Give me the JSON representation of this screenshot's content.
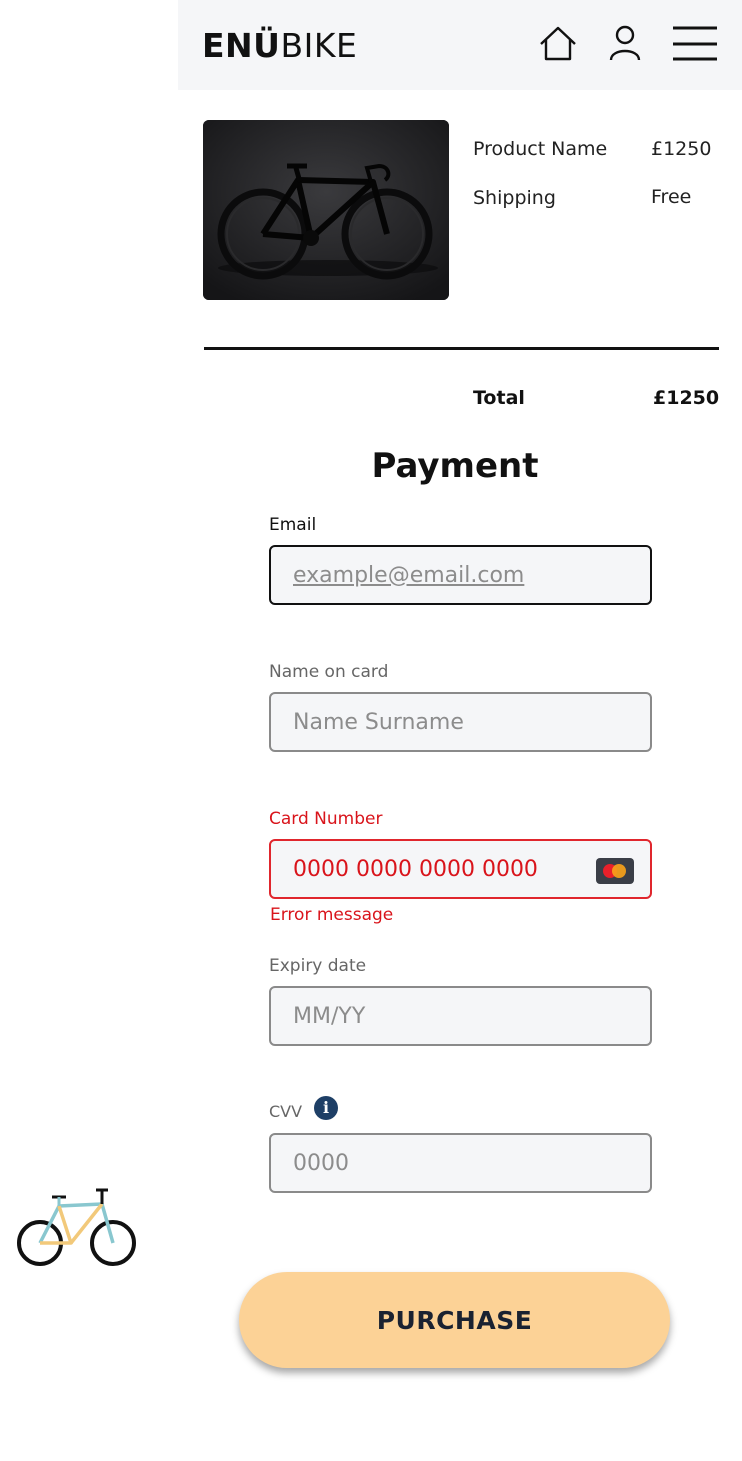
{
  "header": {
    "logo_strong": "ENÜ",
    "logo_light": "BIKE",
    "icons": [
      "home-icon",
      "user-icon",
      "menu-icon"
    ]
  },
  "order": {
    "product_label": "Product Name",
    "product_price": "£1250",
    "shipping_label": "Shipping",
    "shipping_value": "Free",
    "total_label": "Total",
    "total_value": "£1250"
  },
  "payment": {
    "title": "Payment",
    "email": {
      "label": "Email",
      "placeholder": "example@email.com"
    },
    "name": {
      "label": "Name on card",
      "placeholder": "Name Surname"
    },
    "card": {
      "label": "Card Number",
      "placeholder": "0000 0000 0000 0000",
      "error": "Error message",
      "icon": "mastercard-icon"
    },
    "expiry": {
      "label": "Expiry date",
      "placeholder": "MM/YY"
    },
    "cvv": {
      "label": "CVV",
      "placeholder": "0000",
      "info_icon": "info-icon"
    },
    "purchase_label": "PURCHASE"
  },
  "colors": {
    "error": "#d9141b",
    "button": "#fcd296",
    "header_bg": "#f5f6f8",
    "info": "#1e3f66"
  }
}
